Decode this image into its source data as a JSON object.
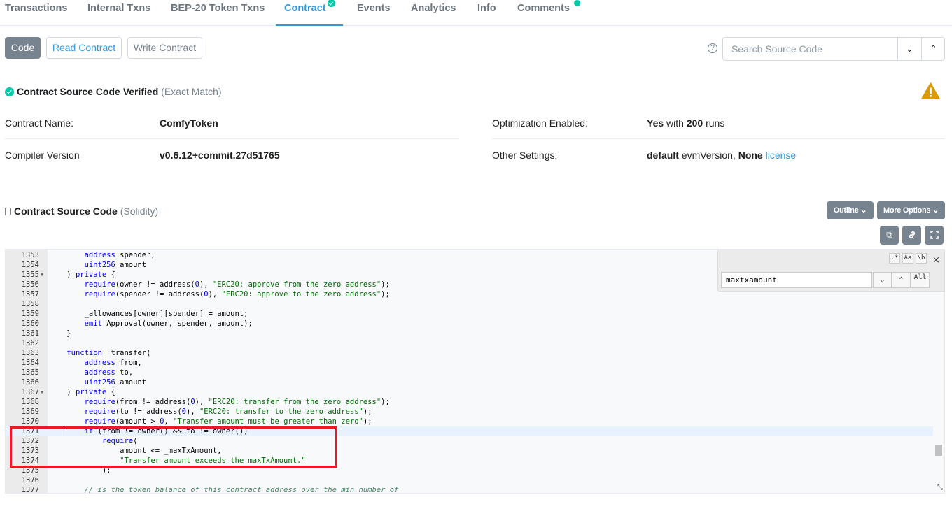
{
  "tabs": [
    {
      "label": "Transactions"
    },
    {
      "label": "Internal Txns"
    },
    {
      "label": "BEP-20 Token Txns"
    },
    {
      "label": "Contract"
    },
    {
      "label": "Events"
    },
    {
      "label": "Analytics"
    },
    {
      "label": "Info"
    },
    {
      "label": "Comments"
    }
  ],
  "toolbar": {
    "code_label": "Code",
    "read_label": "Read Contract",
    "write_label": "Write Contract",
    "help_glyph": "?",
    "search_placeholder": "Search Source Code",
    "down_glyph": "⌄",
    "up_glyph": "⌃"
  },
  "verified": {
    "title": "Contract Source Code Verified",
    "match": "(Exact Match)"
  },
  "info": {
    "contract_name_label": "Contract Name:",
    "contract_name_value": "ComfyToken",
    "compiler_label": "Compiler Version",
    "compiler_value": "v0.6.12+commit.27d51765",
    "optimization_label": "Optimization Enabled:",
    "optimization_yes": "Yes",
    "optimization_with": "with",
    "optimization_runs_num": "200",
    "optimization_runs": "runs",
    "other_label": "Other Settings:",
    "other_default": "default",
    "other_evm": "evmVersion,",
    "other_none": "None",
    "other_license": "license"
  },
  "source": {
    "title": "Contract Source Code",
    "subtitle": "(Solidity)",
    "outline_label": "Outline",
    "more_label": "More Options",
    "copy_glyph": "⧉",
    "link_glyph": "🔗",
    "fullscreen_glyph": "⛶"
  },
  "find": {
    "regex": ".*",
    "case": "Aa",
    "word": "\\b",
    "close": "×",
    "query": "maxtxamount",
    "next": "⌄",
    "prev": "⌃",
    "all": "All"
  },
  "colors": {
    "accent": "#3498db",
    "verified_green": "#00c9a7",
    "warning": "#db9a04",
    "annotation_red": "#e8192c"
  },
  "code_lines": [
    {
      "n": "1353",
      "t": "        address spender,"
    },
    {
      "n": "1354",
      "t": "        uint256 amount"
    },
    {
      "n": "1355",
      "t": "    ) private {",
      "fold": true
    },
    {
      "n": "1356",
      "t": "        require(owner != address(0), \"ERC20: approve from the zero address\");"
    },
    {
      "n": "1357",
      "t": "        require(spender != address(0), \"ERC20: approve to the zero address\");"
    },
    {
      "n": "1358",
      "t": ""
    },
    {
      "n": "1359",
      "t": "        _allowances[owner][spender] = amount;"
    },
    {
      "n": "1360",
      "t": "        emit Approval(owner, spender, amount);"
    },
    {
      "n": "1361",
      "t": "    }"
    },
    {
      "n": "1362",
      "t": ""
    },
    {
      "n": "1363",
      "t": "    function _transfer("
    },
    {
      "n": "1364",
      "t": "        address from,"
    },
    {
      "n": "1365",
      "t": "        address to,"
    },
    {
      "n": "1366",
      "t": "        uint256 amount"
    },
    {
      "n": "1367",
      "t": "    ) private {",
      "fold": true
    },
    {
      "n": "1368",
      "t": "        require(from != address(0), \"ERC20: transfer from the zero address\");"
    },
    {
      "n": "1369",
      "t": "        require(to != address(0), \"ERC20: transfer to the zero address\");"
    },
    {
      "n": "1370",
      "t": "        require(amount > 0, \"Transfer amount must be greater than zero\");"
    },
    {
      "n": "1371",
      "t": "        if (from != owner() && to != owner())",
      "hl": true
    },
    {
      "n": "1372",
      "t": "            require("
    },
    {
      "n": "1373",
      "t": "                amount <= _maxTxAmount,"
    },
    {
      "n": "1374",
      "t": "                \"Transfer amount exceeds the maxTxAmount.\""
    },
    {
      "n": "1375",
      "t": "            );"
    },
    {
      "n": "1376",
      "t": ""
    },
    {
      "n": "1377",
      "t": "        // is the token balance of this contract address over the min number of"
    }
  ]
}
